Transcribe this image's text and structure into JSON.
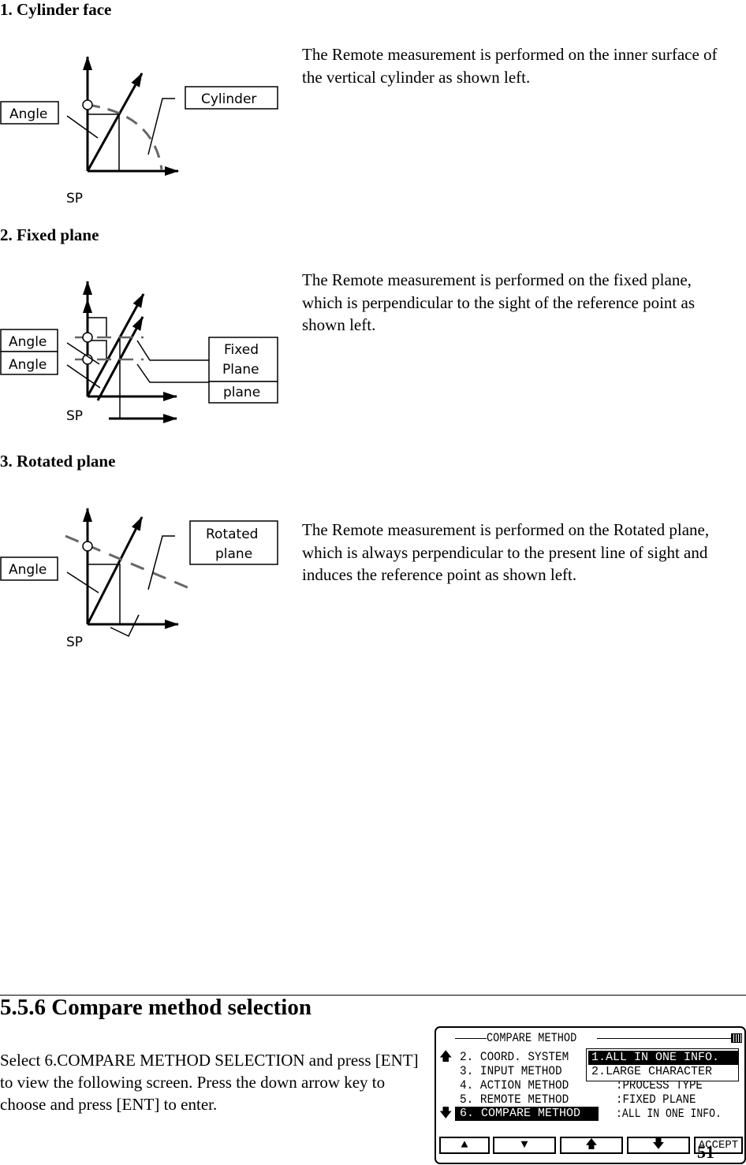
{
  "sections": [
    {
      "heading": "1. Cylinder face",
      "text": "The Remote measurement is performed on the inner surface of the vertical cylinder as shown left.",
      "labels": {
        "angle": "Angle",
        "target": "Cylinder",
        "sp": "SP"
      }
    },
    {
      "heading": "2. Fixed plane",
      "text": "The Remote measurement is performed on the fixed plane, which is perpendicular to the sight of the reference point as shown left.",
      "labels": {
        "angle1": "Angle",
        "angle2": "Angle",
        "target1": "Fixed",
        "target2": "Plane",
        "target3": "plane",
        "sp": "SP"
      }
    },
    {
      "heading": "3. Rotated plane",
      "text": "The Remote measurement is performed on the Rotated plane, which is always perpendicular to the present line of sight and induces the reference point as shown left.",
      "labels": {
        "angle": "Angle",
        "target1": "Rotated",
        "target2": "plane",
        "sp": "SP"
      }
    }
  ],
  "compare": {
    "title": "5.5.6 Compare method selection",
    "text": "Select 6.COMPARE METHOD SELECTION and press [ENT] to view the following screen. Press the down arrow key to choose and press [ENT] to enter."
  },
  "lcd": {
    "title": "COMPARE METHOD",
    "battery_icon": "battery-icon",
    "rows": [
      {
        "label": "2. COORD. SYSTEM",
        "value": ""
      },
      {
        "label": "3. INPUT METHOD",
        "value": ""
      },
      {
        "label": "4. ACTION METHOD",
        "value": ":PROCESS TYPE"
      },
      {
        "label": "5. REMOTE METHOD",
        "value": ":FIXED PLANE"
      },
      {
        "label": "6. COMPARE METHOD",
        "value": ":ALL IN ONE INFO."
      }
    ],
    "popup": [
      "1.ALL IN ONE INFO.",
      "2.LARGE CHARACTER"
    ],
    "popup_selected": 0,
    "selected_row": 4,
    "buttons": [
      "▲",
      "▼",
      "🡅",
      "🡇",
      "ACCEPT"
    ]
  },
  "page_number": "51"
}
